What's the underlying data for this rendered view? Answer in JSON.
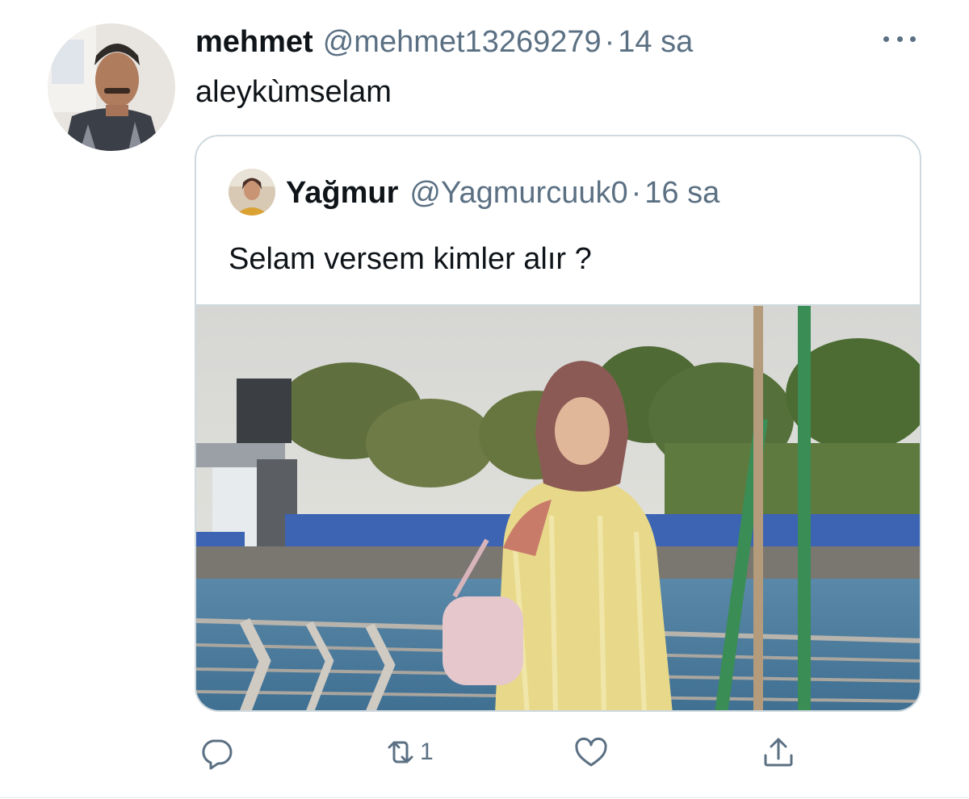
{
  "tweet": {
    "author_name": "mehmet",
    "author_handle": "@mehmet13269279",
    "separator": "·",
    "time": "14 sa",
    "text": "aleykùmselam",
    "more_icon": "more-horizontal-icon"
  },
  "quoted": {
    "author_name": "Yağmur",
    "author_handle": "@Yagmurcuuk0",
    "separator": "·",
    "time": "16 sa",
    "text": "Selam versem kimler alır ?"
  },
  "actions": {
    "reply_icon": "reply-icon",
    "retweet_icon": "retweet-icon",
    "retweet_count": "1",
    "like_icon": "heart-icon",
    "share_icon": "share-icon"
  },
  "colors": {
    "primary_text": "#0f1419",
    "secondary_text": "#5b7083",
    "border": "#cfd9de"
  }
}
